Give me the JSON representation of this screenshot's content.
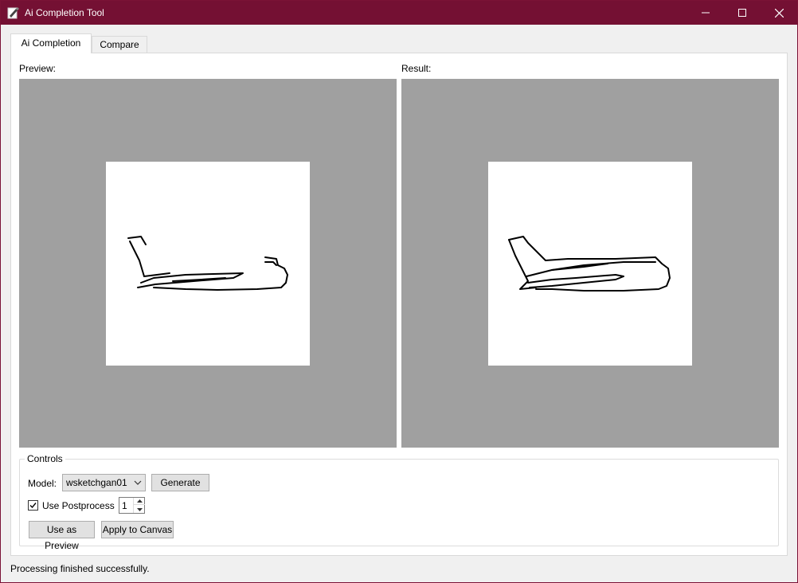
{
  "window": {
    "title": "Ai Completion Tool",
    "accent_color": "#741033",
    "icons": [
      "app-icon",
      "minimize-icon",
      "maximize-icon",
      "close-icon"
    ]
  },
  "tabs": [
    {
      "label": "Ai Completion",
      "active": true
    },
    {
      "label": "Compare",
      "active": false
    }
  ],
  "preview": {
    "label": "Preview:",
    "image": "airplane-sketch-partial"
  },
  "result": {
    "label": "Result:",
    "image": "airplane-sketch-completed"
  },
  "controls": {
    "title": "Controls",
    "model_label": "Model:",
    "model_value": "wsketchgan01",
    "generate_label": "Generate",
    "postprocess_label": "Use Postprocess",
    "postprocess_checked": true,
    "postprocess_iterations": "1",
    "use_as_preview_label": "Use as Preview",
    "apply_to_canvas_label": "Apply to Canvas"
  },
  "status": {
    "text": "Processing finished successfully."
  }
}
